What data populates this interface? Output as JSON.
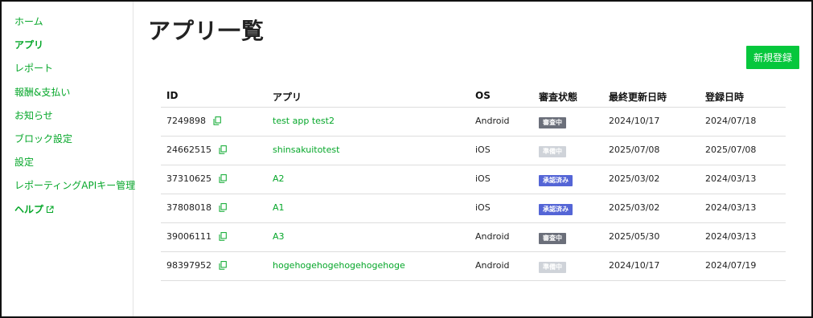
{
  "sidebar": {
    "items": [
      {
        "label": "ホーム",
        "bold": false,
        "external": false
      },
      {
        "label": "アプリ",
        "bold": true,
        "external": false
      },
      {
        "label": "レポート",
        "bold": false,
        "external": false
      },
      {
        "label": "報酬&支払い",
        "bold": false,
        "external": false
      },
      {
        "label": "お知らせ",
        "bold": false,
        "external": false
      },
      {
        "label": "ブロック設定",
        "bold": false,
        "external": false
      },
      {
        "label": "設定",
        "bold": false,
        "external": false
      },
      {
        "label": "レポーティングAPIキー管理",
        "bold": false,
        "external": false
      },
      {
        "label": "ヘルプ",
        "bold": true,
        "external": true
      }
    ]
  },
  "main": {
    "title": "アプリ一覧",
    "new_button_label": "新規登録"
  },
  "table": {
    "headers": {
      "id": "ID",
      "app": "アプリ",
      "os": "OS",
      "status": "審査状態",
      "updated": "最終更新日時",
      "registered": "登録日時"
    },
    "rows": [
      {
        "id": "7249898",
        "app": "test app test2",
        "os": "Android",
        "status": "審査中",
        "updated": "2024/10/17",
        "registered": "2024/07/18"
      },
      {
        "id": "24662515",
        "app": "shinsakuitotest",
        "os": "iOS",
        "status": "準備中",
        "updated": "2025/07/08",
        "registered": "2025/07/08"
      },
      {
        "id": "37310625",
        "app": "A2",
        "os": "iOS",
        "status": "承認済み",
        "updated": "2025/03/02",
        "registered": "2024/03/13"
      },
      {
        "id": "37808018",
        "app": "A1",
        "os": "iOS",
        "status": "承認済み",
        "updated": "2025/03/02",
        "registered": "2024/03/13"
      },
      {
        "id": "39006111",
        "app": "A3",
        "os": "Android",
        "status": "審査中",
        "updated": "2025/05/30",
        "registered": "2024/03/13"
      },
      {
        "id": "98397952",
        "app": "hogehogehogehogehogehoge",
        "os": "Android",
        "status": "準備中",
        "updated": "2024/10/17",
        "registered": "2024/07/19"
      }
    ]
  },
  "colors": {
    "accent": "#06a72a",
    "button": "#06c73c",
    "status_reviewing": "#6b6f7a",
    "status_preparing": "#cfd3d9",
    "status_approved": "#5465d6"
  },
  "icons": {
    "copy": "copy-icon",
    "external": "external-link-icon"
  }
}
